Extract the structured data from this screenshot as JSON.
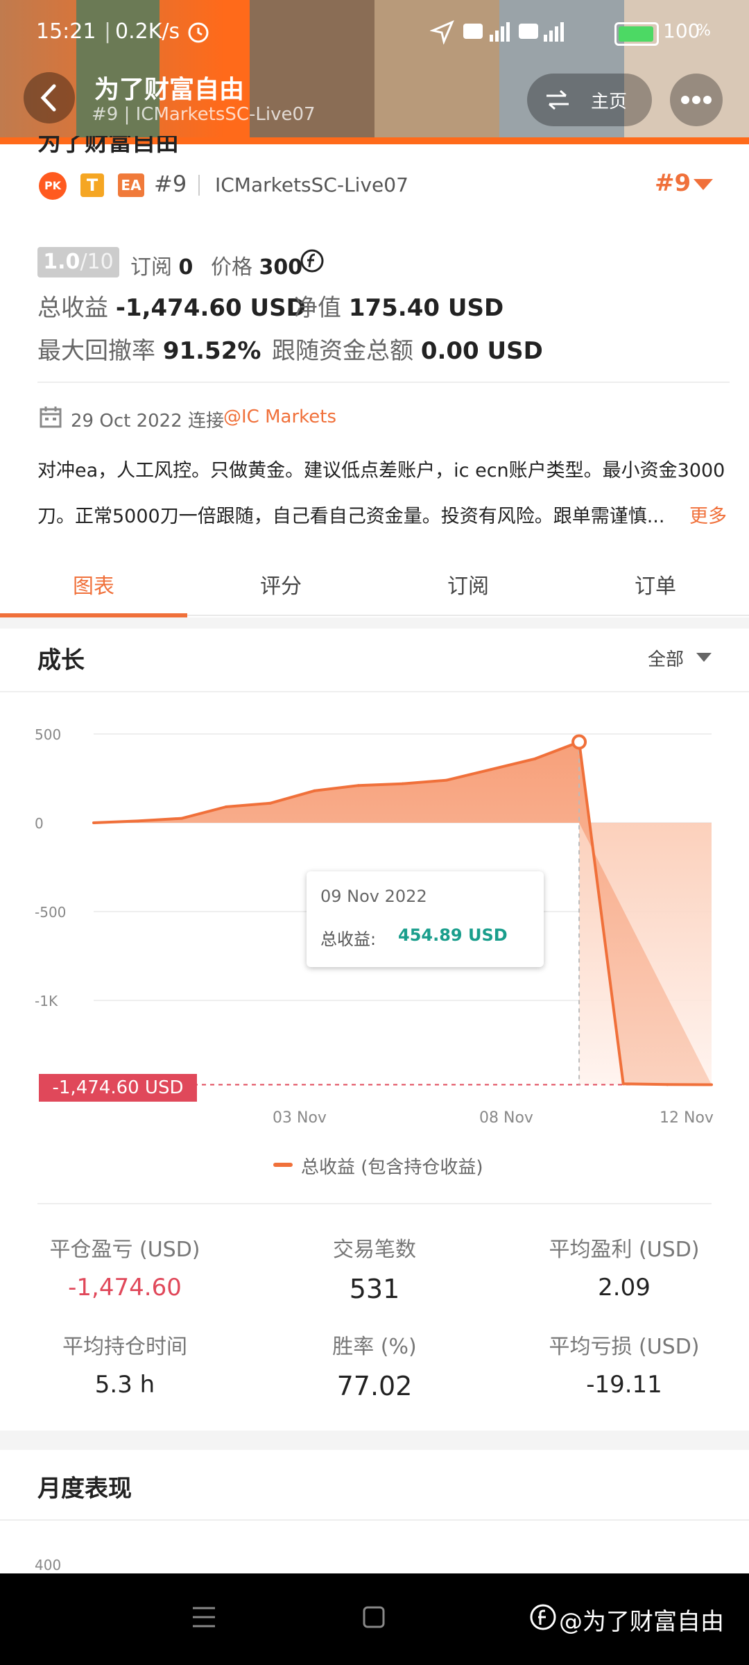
{
  "status_bar": {
    "time": "15:21",
    "speed": "0.2K/s",
    "battery": "100"
  },
  "header": {
    "title": "为了财富自由",
    "subtitle": "#9 | ICMarketsSC-Live07",
    "home_label": "主页"
  },
  "profile": {
    "name_partial": "为了财富自由",
    "tag_pk": "PK",
    "tag_t": "T",
    "tag_ea": "EA",
    "rank": "#9",
    "server": "ICMarketsSC-Live07",
    "rank_right": "#9"
  },
  "metrics": {
    "score": "1.0",
    "score_max": "/10",
    "subs_label": "订阅",
    "subs_value": "0",
    "price_label": "价格",
    "price_value": "300",
    "total_label": "总收益",
    "total_value": "-1,474.60 USD",
    "equity_label": "净值",
    "equity_value": "175.40 USD",
    "dd_label": "最大回撤率",
    "dd_value": "91.52%",
    "follow_label": "跟随资金总额",
    "follow_value": "0.00 USD"
  },
  "connect": {
    "date": "29 Oct 2022 连接",
    "broker": "@IC Markets"
  },
  "description": {
    "line1": "对冲ea，人工风控。只做黄金。建议低点差账户，ic ecn账户类型。最小资金3000",
    "line2": "刀。正常5000刀一倍跟随，自己看自己资金量。投资有风险。跟单需谨慎...",
    "more": "更多"
  },
  "tabs": [
    "图表",
    "评分",
    "订阅",
    "订单"
  ],
  "growth": {
    "title": "成长",
    "filter": "全部"
  },
  "tooltip": {
    "date": "09 Nov 2022",
    "label": "总收益:",
    "value": "454.89 USD"
  },
  "current_label": "-1,474.60 USD",
  "chart_data": {
    "type": "area",
    "yticks": [
      "500",
      "0",
      "-500",
      "-1K"
    ],
    "xticks": [
      "03 Nov",
      "08 Nov",
      "12 Nov"
    ],
    "ylim": [
      -1500,
      550
    ],
    "legend": "总收益 (包含持仓收益)",
    "series": [
      {
        "name": "总收益 (包含持仓收益)",
        "x": [
          "29 Oct",
          "30 Oct",
          "31 Oct",
          "01 Nov",
          "02 Nov",
          "03 Nov",
          "04 Nov",
          "05 Nov",
          "06 Nov",
          "07 Nov",
          "08 Nov",
          "09 Nov",
          "10 Nov",
          "11 Nov",
          "12 Nov"
        ],
        "values": [
          0,
          10,
          25,
          90,
          110,
          180,
          210,
          220,
          240,
          300,
          360,
          455,
          -1470,
          -1474,
          -1474.6
        ]
      }
    ]
  },
  "stats": [
    {
      "label": "平仓盈亏 (USD)",
      "value": "-1,474.60"
    },
    {
      "label": "交易笔数",
      "value": "531"
    },
    {
      "label": "平均盈利 (USD)",
      "value": "2.09"
    },
    {
      "label": "平均持仓时间",
      "value": "5.3 h"
    },
    {
      "label": "胜率 (%)",
      "value": "77.02"
    },
    {
      "label": "平均亏损 (USD)",
      "value": "-19.11"
    }
  ],
  "monthly": {
    "title": "月度表现",
    "first_tick": "400"
  },
  "watermark": "@为了财富自由",
  "colors": {
    "accent": "#f0703a",
    "negative": "#e0485a",
    "positive": "#1a9e8c"
  }
}
